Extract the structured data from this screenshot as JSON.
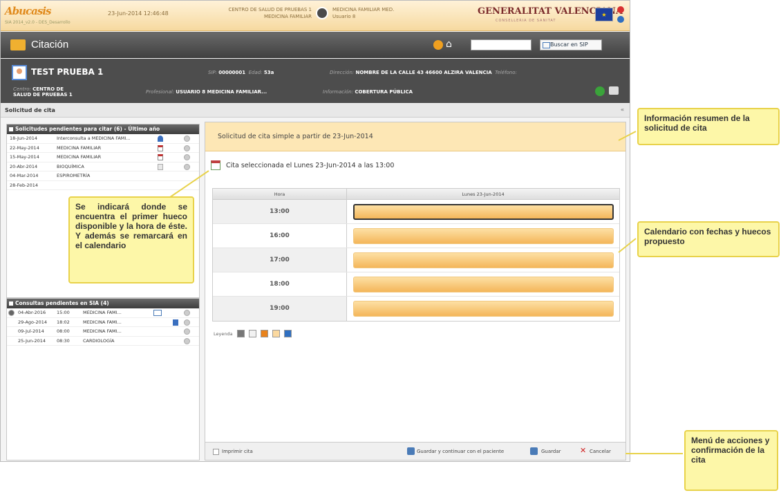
{
  "banner": {
    "logo": "Abucasis",
    "logo_sub": "SIA 2014_v2.0 - DES_Desarrollo",
    "datetime": "23-Jun-2014 12:46:48",
    "center_line1": "CENTRO DE SALUD DE PRUEBAS 1",
    "center_line2": "MEDICINA FAMILIAR",
    "user_line1": "MEDICINA FAMILIAR MED.",
    "user_line2": "Usuario 8",
    "gv_name": "GENERALITAT VALENCIANA",
    "gv_sub": "CONSELLERIA DE SANITAT"
  },
  "titlebar": {
    "title": "Citación",
    "search_placeholder": "",
    "sip_button": "Buscar en SIP"
  },
  "patient": {
    "name": "TEST PRUEBA 1",
    "sip_label": "SIP:",
    "sip_value": "00000001",
    "age_label": "Edad:",
    "age_value": "53a",
    "address_label": "Dirección:",
    "address_value": "NOMBRE DE LA CALLE 43 46600 ALZIRA VALENCIA",
    "phone_label": "Teléfono:",
    "center_label": "Centro:",
    "center_value": "CENTRO DE SALUD DE PRUEBAS 1",
    "prof_label": "Profesional:",
    "prof_value": "USUARIO 8 MEDICINA FAMILIAR...",
    "info_label": "Información:",
    "info_value": "COBERTURA PÚBLICA"
  },
  "solicitud_bar": {
    "title": "Solicitud de cita",
    "collapse": "«"
  },
  "pending_panel": {
    "title": "Solicitudes pendientes para citar (6) - Último año",
    "rows": [
      {
        "date": "18-Jun-2014",
        "service": "Interconsulta a MEDICINA FAMI..."
      },
      {
        "date": "22-May-2014",
        "service": "MEDICINA FAMILIAR"
      },
      {
        "date": "15-May-2014",
        "service": "MEDICINA FAMILIAR"
      },
      {
        "date": "20-Abr-2014",
        "service": "BIOQUÍMICA"
      },
      {
        "date": "04-Mar-2014",
        "service": "ESPIROMETRÍA"
      },
      {
        "date": "28-Feb-2014",
        "service": ""
      }
    ]
  },
  "consult_panel": {
    "title": "Consultas pendientes en SIA (4)",
    "rows": [
      {
        "date": "04-Abr-2016",
        "time": "15:00",
        "service": "MEDICINA FAMI..."
      },
      {
        "date": "29-Ago-2014",
        "time": "18:02",
        "service": "MEDICINA FAMI..."
      },
      {
        "date": "09-Jul-2014",
        "time": "08:00",
        "service": "MEDICINA FAMI..."
      },
      {
        "date": "25-Jun-2014",
        "time": "08:30",
        "service": "CARDIOLOGÍA"
      }
    ]
  },
  "main": {
    "header": "Solicitud de cita simple a partir de 23-Jun-2014",
    "selected": "Cita seleccionada el Lunes 23-Jun-2014 a las 13:00",
    "col_hour": "Hora",
    "col_day": "Lunes 23-Jun-2014",
    "hours": [
      "13:00",
      "16:00",
      "17:00",
      "18:00",
      "19:00"
    ],
    "legend_label": "Leyenda",
    "legend_colors": [
      "#777777",
      "#f2f2f2",
      "#e8821c",
      "#fbd9a0",
      "#2f6fc0"
    ]
  },
  "footer": {
    "print_label": "Imprimir cita",
    "save_continue": "Guardar y continuar con el paciente",
    "save": "Guardar",
    "cancel": "Cancelar"
  },
  "callouts": {
    "summary": "Información resumen de la solicitud de cita",
    "first_slot": "Se indicará donde se encuentra el primer hueco disponible y la hora de éste. Y además se remarcará en el calendario",
    "calendar": "Calendario con fechas y huecos propuesto",
    "menu": "Menú de acciones y confirmación de la cita"
  }
}
